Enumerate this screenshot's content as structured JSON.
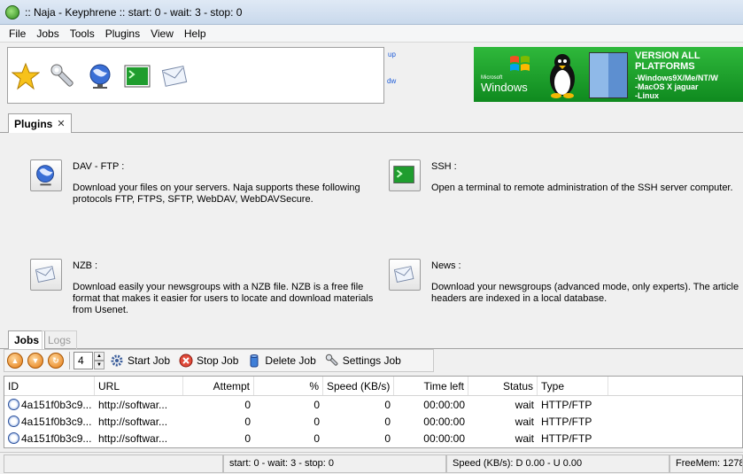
{
  "window": {
    "title": ":: Naja - Keyphrene :: start: 0  -  wait: 3  -  stop: 0"
  },
  "menu": [
    "File",
    "Jobs",
    "Tools",
    "Plugins",
    "View",
    "Help"
  ],
  "toolbar": {
    "link_up": "up",
    "link_dw": "dw"
  },
  "banner": {
    "windows_label": "Windows",
    "windows_small": "Microsoft",
    "version_title_1": "VERSION ALL",
    "version_title_2": "PLATFORMS",
    "platform_1": "-Windows9X/Me/NT/W",
    "platform_2": "-MacOS X jaguar",
    "platform_3": "-Linux"
  },
  "plugins_tab": {
    "label": "Plugins",
    "close": "✕"
  },
  "plugins": [
    {
      "name": "DAV - FTP :",
      "desc": "Download your files on your servers. Naja supports these following protocols FTP, FTPS, SFTP, WebDAV, WebDAVSecure."
    },
    {
      "name": "SSH :",
      "desc": "Open a terminal to remote administration of the SSH server computer."
    },
    {
      "name": "NZB :",
      "desc": "Download easily your newsgroups with a NZB file. NZB is a free file format that makes it easier for users to locate and download materials from Usenet."
    },
    {
      "name": "News :",
      "desc": "Download your newsgroups (advanced mode, only experts). The article headers are indexed in a local database."
    }
  ],
  "bottom_tabs": {
    "jobs": "Jobs",
    "logs": "Logs"
  },
  "jobs_toolbar": {
    "concurrent": "4",
    "start": "Start Job",
    "stop": "Stop Job",
    "delete": "Delete Job",
    "settings": "Settings Job"
  },
  "table": {
    "headers": [
      "ID",
      "URL",
      "Attempt",
      "%",
      "Speed (KB/s)",
      "Time left",
      "Status",
      "Type"
    ],
    "rows": [
      {
        "id": "4a151f0b3c9...",
        "url": "http://softwar...",
        "attempt": "0",
        "pct": "0",
        "speed": "0",
        "time": "00:00:00",
        "status": "wait",
        "type": "HTTP/FTP"
      },
      {
        "id": "4a151f0b3c9...",
        "url": "http://softwar...",
        "attempt": "0",
        "pct": "0",
        "speed": "0",
        "time": "00:00:00",
        "status": "wait",
        "type": "HTTP/FTP"
      },
      {
        "id": "4a151f0b3c9...",
        "url": "http://softwar...",
        "attempt": "0",
        "pct": "0",
        "speed": "0",
        "time": "00:00:00",
        "status": "wait",
        "type": "HTTP/FTP"
      }
    ]
  },
  "status": {
    "counts": "start: 0  -  wait: 3  -  stop: 0",
    "speed": "Speed (KB/s): D 0.00 - U 0.00",
    "mem": "FreeMem: 1278"
  },
  "icons": [
    "star-icon",
    "wrench-icon",
    "globe-icon",
    "terminal-icon",
    "envelope-icon",
    "windows-logo",
    "tux-logo",
    "mac-logo"
  ],
  "colors": {
    "banner_green": "#1a9a2a",
    "link_blue": "#1c5bd8",
    "orange_button": "#e47a12"
  }
}
